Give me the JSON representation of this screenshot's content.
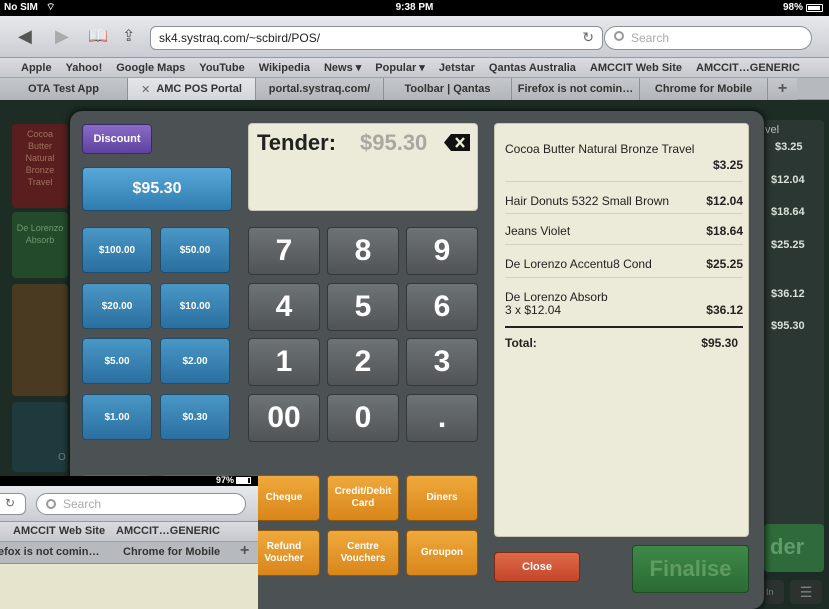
{
  "status_bar": {
    "carrier": "No SIM",
    "time": "9:38 PM",
    "battery": "98%"
  },
  "browser": {
    "url": "sk4.systraq.com/~scbird/POS/",
    "search_placeholder": "Search",
    "bookmarks": [
      "Apple",
      "Yahoo!",
      "Google Maps",
      "YouTube",
      "Wikipedia",
      "News ▾",
      "Popular ▾",
      "Jetstar",
      "Qantas Australia",
      "AMCCIT Web Site",
      "AMCCIT…GENERIC"
    ],
    "tabs": [
      "OTA Test App",
      "AMC POS Portal",
      "portal.systraq.com/",
      "Toolbar | Qantas",
      "Firefox is not comin…",
      "Chrome for Mobile"
    ],
    "new_tab": "+"
  },
  "background": {
    "tiles": [
      "Cocoa Butter Natural Bronze Travel",
      "De Lorenzo Absorb"
    ],
    "right_label": "vel",
    "right_prices": [
      "$3.25",
      "$12.04",
      "$18.64",
      "$25.25",
      "$36.12",
      "$95.30"
    ],
    "tender_fragment": "der",
    "bottom_left_fragment": "O",
    "bottom_right_fragment": "In"
  },
  "modal": {
    "discount": "Discount",
    "exact_amount": "$95.30",
    "quick_amounts": [
      "$100.00",
      "$50.00",
      "$20.00",
      "$10.00",
      "$5.00",
      "$2.00",
      "$1.00",
      "$0.30"
    ],
    "tender_label": "Tender:",
    "tender_amount": "$95.30",
    "keypad": [
      "7",
      "8",
      "9",
      "4",
      "5",
      "6",
      "1",
      "2",
      "3",
      "00",
      "0",
      "."
    ],
    "payment_buttons": [
      "Cheque",
      "Credit/Debit Card",
      "Diners",
      "Refund Voucher",
      "Centre Vouchers",
      "Groupon"
    ],
    "close": "Close",
    "finalise": "Finalise"
  },
  "receipt": {
    "items": [
      {
        "name": "Cocoa Butter Natural Bronze Travel",
        "detail": "",
        "price": "$3.25"
      },
      {
        "name": "Hair Donuts 5322 Small Brown",
        "detail": "",
        "price": "$12.04"
      },
      {
        "name": "Jeans Violet",
        "detail": "",
        "price": "$18.64"
      },
      {
        "name": "De Lorenzo Accentu8 Cond",
        "detail": "",
        "price": "$25.25"
      },
      {
        "name": "De Lorenzo Absorb",
        "detail": "3 x $12.04",
        "price": "$36.12"
      }
    ],
    "total_label": "Total:",
    "total": "$95.30"
  },
  "overlay": {
    "battery": "97%",
    "search_placeholder": "Search",
    "bookmarks": [
      "AMCCIT Web Site",
      "AMCCIT…GENERIC"
    ],
    "tabs": [
      "efox is not comin…",
      "Chrome for Mobile"
    ],
    "new_tab": "+"
  }
}
